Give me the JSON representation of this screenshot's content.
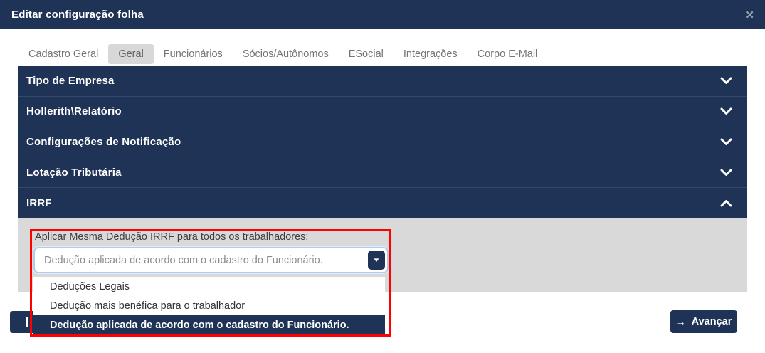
{
  "colors": {
    "navy": "#1F3356",
    "panel_gray": "#D9D9D9",
    "tab_active_bg": "#D8D8D8",
    "select_border": "#AECBEE",
    "annotation_red": "#FE0000"
  },
  "modal": {
    "title": "Editar configuração folha"
  },
  "icons": {
    "close": "✕",
    "advance_arrow": "→",
    "select_caret": "▼"
  },
  "tabs": [
    {
      "label": "Cadastro Geral",
      "active": false
    },
    {
      "label": "Geral",
      "active": true
    },
    {
      "label": "Funcionários",
      "active": false
    },
    {
      "label": "Sócios/Autônomos",
      "active": false
    },
    {
      "label": "ESocial",
      "active": false
    },
    {
      "label": "Integrações",
      "active": false
    },
    {
      "label": "Corpo E-Mail",
      "active": false
    }
  ],
  "accordion": [
    {
      "label": "Tipo de Empresa",
      "expanded": false
    },
    {
      "label": "Hollerith\\Relatório",
      "expanded": false
    },
    {
      "label": "Configurações de Notificação",
      "expanded": false
    },
    {
      "label": "Lotação Tributária",
      "expanded": false
    },
    {
      "label": "IRRF",
      "expanded": true
    }
  ],
  "irrf": {
    "field_label": "Aplicar Mesma Dedução IRRF para todos os trabalhadores:",
    "select": {
      "value": "Dedução aplicada de acordo com o cadastro do Funcionário."
    },
    "options": [
      {
        "label": "Deduções Legais",
        "selected": false
      },
      {
        "label": "Dedução mais benéfica para o trabalhador",
        "selected": false
      },
      {
        "label": "Dedução aplicada de acordo com o cadastro do Funcionário.",
        "selected": true
      }
    ]
  },
  "footer": {
    "advance_label": "Avançar"
  }
}
